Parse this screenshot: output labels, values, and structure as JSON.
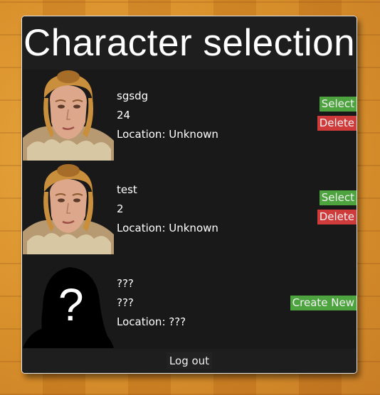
{
  "title": "Character selection",
  "characters": [
    {
      "name": "sgsdg",
      "level": "24",
      "location": "Location: Unknown",
      "select_label": "Select",
      "delete_label": "Delete"
    },
    {
      "name": "test",
      "level": "2",
      "location": "Location: Unknown",
      "select_label": "Select",
      "delete_label": "Delete"
    }
  ],
  "empty_slot": {
    "name": "???",
    "level": "???",
    "location": "Location: ???",
    "placeholder_glyph": "?",
    "create_label": "Create New"
  },
  "footer": {
    "logout_label": "Log out"
  },
  "colors": {
    "panel_bg": "#1b1b1b",
    "select_green": "#4da43f",
    "delete_red": "#cf3b3b",
    "background_wood": "#d9932e"
  }
}
